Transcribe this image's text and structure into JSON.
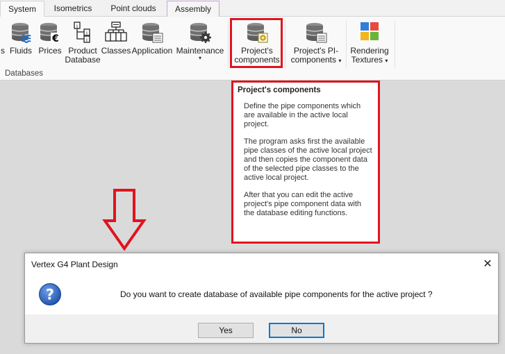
{
  "tabs": [
    {
      "label": "System"
    },
    {
      "label": "Isometrics"
    },
    {
      "label": "Point clouds"
    },
    {
      "label": "Assembly"
    }
  ],
  "ribbon": {
    "group_label": "Databases",
    "buttons": {
      "partial": {
        "label": "s"
      },
      "fluids": {
        "label": "Fluids"
      },
      "prices": {
        "label": "Prices"
      },
      "product_db": {
        "line1": "Product",
        "line2": "Database"
      },
      "classes": {
        "label": "Classes"
      },
      "application": {
        "label": "Application"
      },
      "maintenance": {
        "label": "Maintenance",
        "caret": "▾"
      },
      "projects_components": {
        "line1": "Project's",
        "line2": "components"
      },
      "projects_pi": {
        "line1": "Project's PI-",
        "line2": "components",
        "caret": "▾"
      },
      "rendering": {
        "line1": "Rendering",
        "line2": "Textures",
        "caret": "▾"
      }
    }
  },
  "tooltip": {
    "title": "Project's components",
    "paragraphs": [
      "Define the pipe components which are available in the active local project.",
      "The program asks first the available pipe classes of the active local project and then copies the component data of the selected pipe classes to the active local project.",
      "After that you can edit the active project's pipe component data with the database editing functions."
    ]
  },
  "dialog": {
    "title": "Vertex G4 Plant Design",
    "close_glyph": "✕",
    "message": "Do you want to create database of available pipe components for the active project ?",
    "yes_label": "Yes",
    "no_label": "No"
  },
  "colors": {
    "highlight": "#e0141e",
    "accent": "#0078d7",
    "question_icon": "#1c4fa8"
  }
}
